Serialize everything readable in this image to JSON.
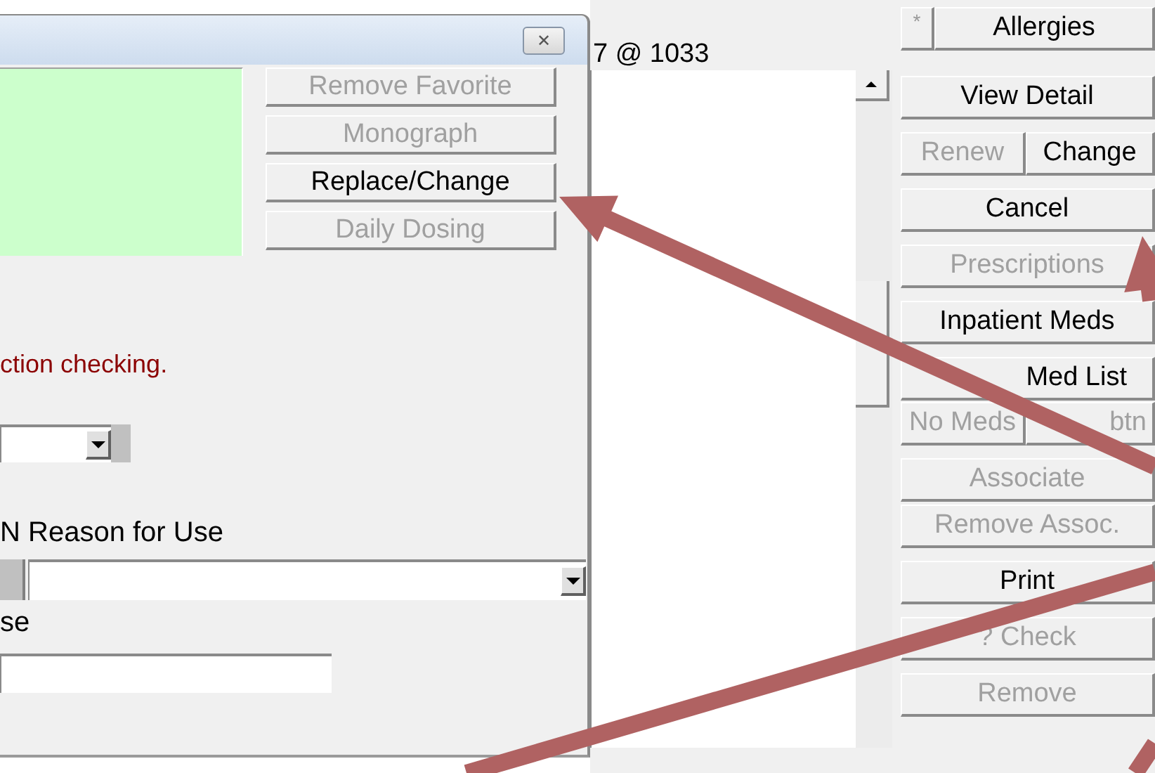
{
  "dialog": {
    "close_label": "✕",
    "buttons": [
      {
        "label": "Remove Favorite",
        "disabled": true
      },
      {
        "label": "Monograph",
        "disabled": true
      },
      {
        "label": "Replace/Change",
        "disabled": false
      },
      {
        "label": "Daily Dosing",
        "disabled": true
      }
    ],
    "message": "ction checking.",
    "reason_label": "N Reason for Use",
    "use_label": "se"
  },
  "order_list": {
    "header": "7 @ 1033"
  },
  "side_panel": {
    "allergy_flag": "*",
    "rows": [
      [
        {
          "label": "Allergies",
          "disabled": false
        }
      ],
      [
        {
          "label": "View Detail",
          "disabled": false
        }
      ],
      [
        {
          "label": "Renew",
          "disabled": true
        },
        {
          "label": "Change",
          "disabled": false
        }
      ],
      [
        {
          "label": "Cancel",
          "disabled": false
        }
      ],
      [
        {
          "label": "Prescriptions",
          "disabled": true
        }
      ],
      [
        {
          "label": "Inpatient Meds",
          "disabled": false
        }
      ],
      [
        {
          "label": "Med List",
          "disabled": false
        }
      ],
      [
        {
          "label": "No Meds",
          "disabled": true
        },
        {
          "label": "btn",
          "disabled": true
        }
      ],
      [
        {
          "label": "Associate",
          "disabled": true
        }
      ],
      [
        {
          "label": "Remove Assoc.",
          "disabled": true
        }
      ],
      [
        {
          "label": "Print",
          "disabled": false
        }
      ],
      [
        {
          "label": "? Check",
          "disabled": true
        }
      ],
      [
        {
          "label": "Remove",
          "disabled": true
        }
      ]
    ]
  },
  "annotations": [
    {
      "kind": "arrow"
    },
    {
      "kind": "arrow"
    },
    {
      "kind": "arrow"
    },
    {
      "kind": "arrow"
    }
  ]
}
